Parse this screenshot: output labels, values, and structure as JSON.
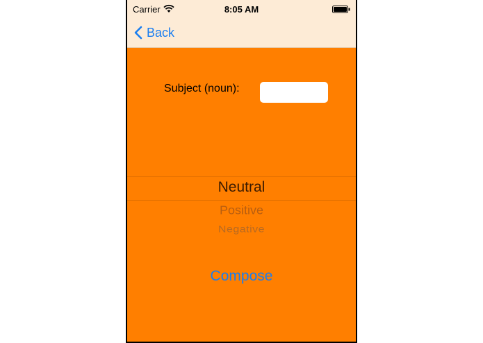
{
  "status_bar": {
    "carrier": "Carrier",
    "time": "8:05 AM",
    "wifi_icon": "wifi-icon",
    "battery_icon": "battery-icon"
  },
  "nav": {
    "back_label": "Back",
    "back_icon": "chevron-left-icon"
  },
  "form": {
    "subject_label": "Subject (noun):",
    "subject_value": "",
    "subject_placeholder": ""
  },
  "picker": {
    "options": [
      "Neutral",
      "Positive",
      "Negative"
    ],
    "selected": "Neutral"
  },
  "actions": {
    "compose_label": "Compose"
  },
  "colors": {
    "background": "#ff7f00",
    "bar": "#fdebd6",
    "tint": "#1a7ef0"
  }
}
